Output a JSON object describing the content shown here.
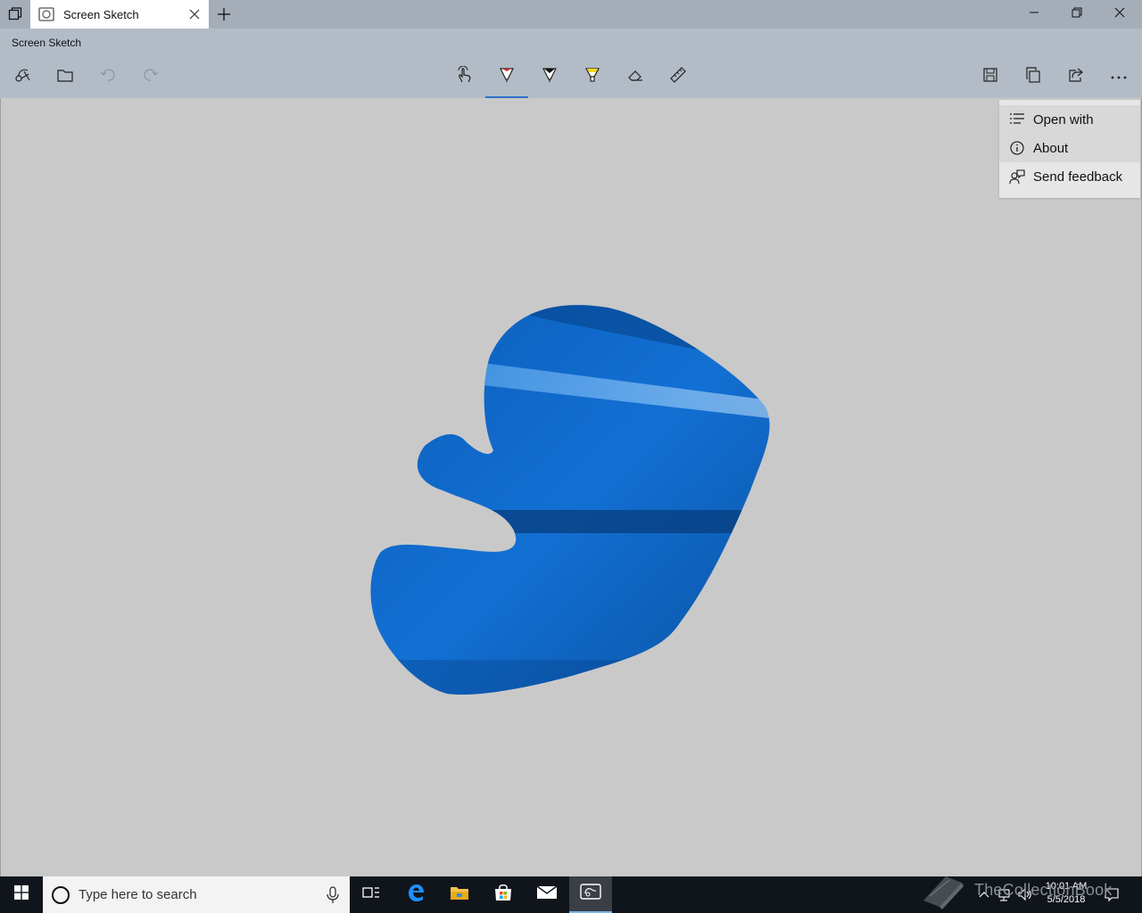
{
  "window": {
    "tab_title": "Screen Sketch",
    "app_title": "Screen Sketch",
    "caption_icons": [
      "minimize-icon",
      "restore-icon",
      "close-icon"
    ]
  },
  "toolbar": {
    "left_icons": [
      "new-snip-icon",
      "open-folder-icon",
      "undo-icon",
      "redo-icon"
    ],
    "tool_icons": [
      "touch-writing-icon",
      "ballpoint-pen-icon",
      "pencil-icon",
      "highlighter-icon",
      "eraser-icon",
      "ruler-icon"
    ],
    "selected_tool": "ballpoint-pen-icon",
    "right_icons": [
      "save-icon",
      "copy-icon",
      "share-icon",
      "more-icon"
    ],
    "pen_color": "#d0272b",
    "highlighter_color": "#f4d81c"
  },
  "menu": {
    "items": [
      {
        "label": "Open with",
        "icon": "open-with-icon"
      },
      {
        "label": "About",
        "icon": "info-icon"
      },
      {
        "label": "Send feedback",
        "icon": "feedback-icon"
      }
    ]
  },
  "taskbar": {
    "search_placeholder": "Type here to search",
    "apps": [
      "task-view-icon",
      "edge-icon",
      "file-explorer-icon",
      "store-icon",
      "mail-icon",
      "screen-sketch-icon"
    ],
    "clock_time": "10:01 AM",
    "clock_date": "5/5/2018",
    "watermark": "TheCollectionBook"
  },
  "colors": {
    "titlebar": "#a4adb8",
    "header": "#b3bcc6",
    "canvas": "#c9c9c9",
    "accent": "#2c72c7",
    "snip_blue": "#0a64c8"
  }
}
